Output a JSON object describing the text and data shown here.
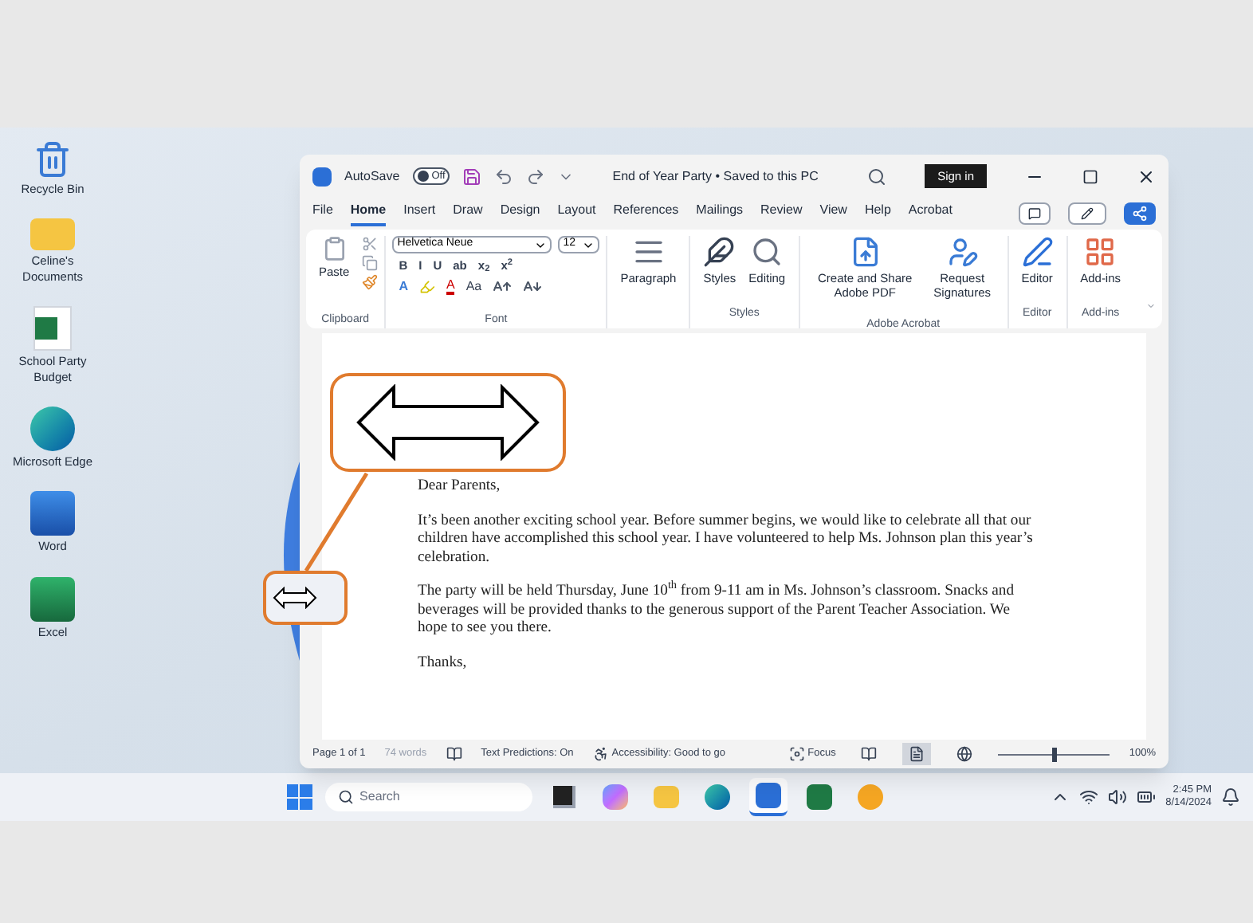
{
  "desktop_icons": [
    {
      "kind": "recycle",
      "label": "Recycle Bin"
    },
    {
      "kind": "folder",
      "label": "Celine's Documents"
    },
    {
      "kind": "excel-file",
      "label": "School Party Budget"
    },
    {
      "kind": "edge",
      "label": "Microsoft Edge"
    },
    {
      "kind": "word",
      "label": "Word"
    },
    {
      "kind": "excel",
      "label": "Excel"
    }
  ],
  "word": {
    "title_bar": {
      "autosave_label": "AutoSave",
      "autosave": {
        "label": "Off",
        "on": false
      },
      "document_title": "End of Year Party • Saved to this PC",
      "sign_in": "Sign in"
    },
    "tabs": [
      {
        "label": "File",
        "selected": false
      },
      {
        "label": "Home",
        "selected": true
      },
      {
        "label": "Insert",
        "selected": false
      },
      {
        "label": "Draw",
        "selected": false
      },
      {
        "label": "Design",
        "selected": false
      },
      {
        "label": "Layout",
        "selected": false
      },
      {
        "label": "References",
        "selected": false
      },
      {
        "label": "Mailings",
        "selected": false
      },
      {
        "label": "Review",
        "selected": false
      },
      {
        "label": "View",
        "selected": false
      },
      {
        "label": "Help",
        "selected": false
      },
      {
        "label": "Acrobat",
        "selected": false
      }
    ],
    "ribbon": {
      "clipboard": {
        "paste": "Paste",
        "group": "Clipboard"
      },
      "font": {
        "name": "Helvetica Neue",
        "size": "12",
        "format_buttons": [
          "B",
          "I",
          "U",
          "ab",
          "x$_{2}$",
          "x$^{2}$"
        ],
        "effects": "A",
        "font_color": "A",
        "change_case": "Aa",
        "group": "Font"
      },
      "paragraph": "Paragraph",
      "styles": {
        "label": "Styles",
        "group": "Styles"
      },
      "editing": "Editing",
      "acrobat": {
        "create": "Create and Share Adobe PDF",
        "request": "Request Signatures",
        "group": "Adobe Acrobat"
      },
      "editor": {
        "label": "Editor",
        "group": "Editor"
      },
      "addins": {
        "label": "Add-ins",
        "group": "Add-ins"
      }
    },
    "document": {
      "paragraphs": [
        "Dear Parents,",
        "It’s been another exciting school year. Before summer begins, we would like to celebrate all that our children have accomplished this school year. I have volunteered to help Ms. Johnson plan this year’s celebration.",
        "The party will be held Thursday, June 10$^{th}$ from 9-11 am in Ms. Johnson’s classroom. Snacks and beverages will be provided thanks to the generous support of the Parent Teacher Association. We hope to see you there.",
        "Thanks,"
      ]
    },
    "status_bar": {
      "page": "Page 1 of 1",
      "words": "74 words",
      "text_predictions": "Text Predictions: On",
      "accessibility": "Accessibility: Good to go",
      "focus": "Focus",
      "views": [
        {
          "kind": "read",
          "selected": false
        },
        {
          "kind": "print",
          "selected": true
        },
        {
          "kind": "web",
          "selected": false
        }
      ],
      "zoom": {
        "level": 0.5,
        "reading": "100%"
      }
    }
  },
  "taskbar": {
    "search_placeholder": "Search",
    "apps": [
      {
        "kind": "task-view",
        "selected": false
      },
      {
        "kind": "copilot",
        "selected": false
      },
      {
        "kind": "folder",
        "selected": false
      },
      {
        "kind": "edge",
        "selected": false
      },
      {
        "kind": "word",
        "selected": true
      },
      {
        "kind": "excel",
        "selected": false
      },
      {
        "kind": "chrome",
        "selected": false
      }
    ],
    "time": "2:45 PM",
    "date": "8/14/2024"
  }
}
